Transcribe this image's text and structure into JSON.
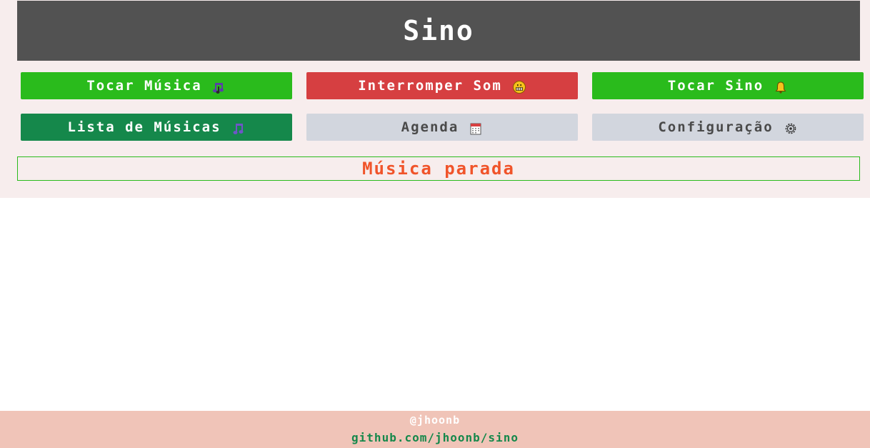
{
  "app": {
    "title": "Sino"
  },
  "buttons": {
    "play_music": {
      "label": "Tocar Música",
      "icon": "music-notes-icon",
      "color": "#2abb1c"
    },
    "stop_sound": {
      "label": "Interromper Som",
      "icon": "grimacing-face-icon",
      "color": "#d63f41"
    },
    "ring_bell": {
      "label": "Tocar Sino",
      "icon": "bell-icon",
      "color": "#2abb1c"
    },
    "music_list": {
      "label": "Lista de Músicas",
      "icon": "music-note-icon",
      "color": "#15884b"
    },
    "schedule": {
      "label": "Agenda",
      "icon": "calendar-icon",
      "color": "#d2d6de"
    },
    "settings": {
      "label": "Configuração",
      "icon": "gear-icon",
      "color": "#d2d6de"
    }
  },
  "status": {
    "text": "Música parada",
    "color": "#f0542a"
  },
  "footer": {
    "user": "@jhoonb",
    "link": "github.com/jhoonb/sino"
  }
}
